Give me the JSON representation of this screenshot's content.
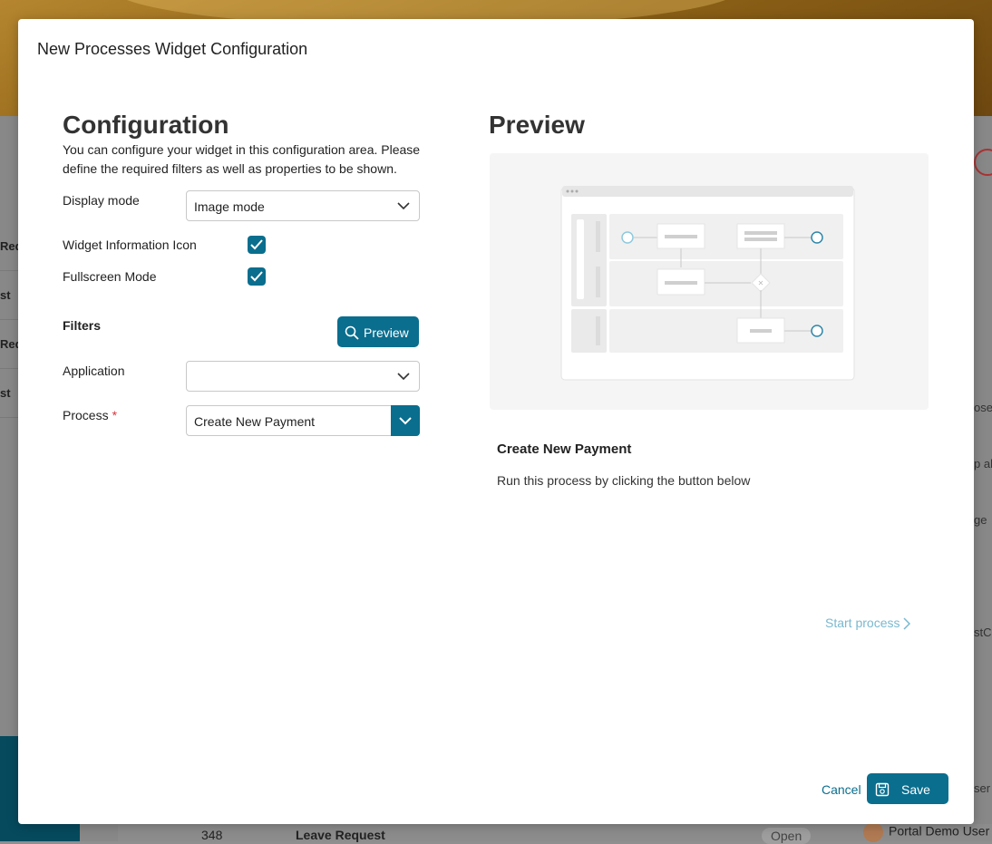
{
  "background": {
    "left_list": [
      "Req",
      "st",
      "Req",
      "st"
    ],
    "right_fragments": [
      "ose",
      "p al",
      "ge",
      "stCa",
      "ser"
    ],
    "bottom_row": {
      "id": "348",
      "name": "Leave Request",
      "status": "Open",
      "user": "Portal Demo User"
    }
  },
  "modal": {
    "title": "New Processes Widget Configuration",
    "configuration": {
      "heading": "Configuration",
      "description": "You can configure your widget in this configuration area. Please define the required filters as well as properties to be shown.",
      "display_mode": {
        "label": "Display mode",
        "value": "Image mode"
      },
      "info_icon": {
        "label": "Widget Information Icon",
        "checked": true
      },
      "fullscreen": {
        "label": "Fullscreen Mode",
        "checked": true
      },
      "filters_label": "Filters",
      "preview_button": "Preview",
      "application": {
        "label": "Application",
        "value": ""
      },
      "process": {
        "label": "Process",
        "required_mark": "*",
        "value": "Create New Payment"
      }
    },
    "preview": {
      "heading": "Preview",
      "process_title": "Create New Payment",
      "process_description": "Run this process by clicking the button below",
      "start_link": "Start process"
    },
    "footer": {
      "cancel": "Cancel",
      "save": "Save"
    }
  },
  "colors": {
    "primary": "#0a6e8e",
    "link_light": "#7ab8cf",
    "required": "#d9363e"
  }
}
